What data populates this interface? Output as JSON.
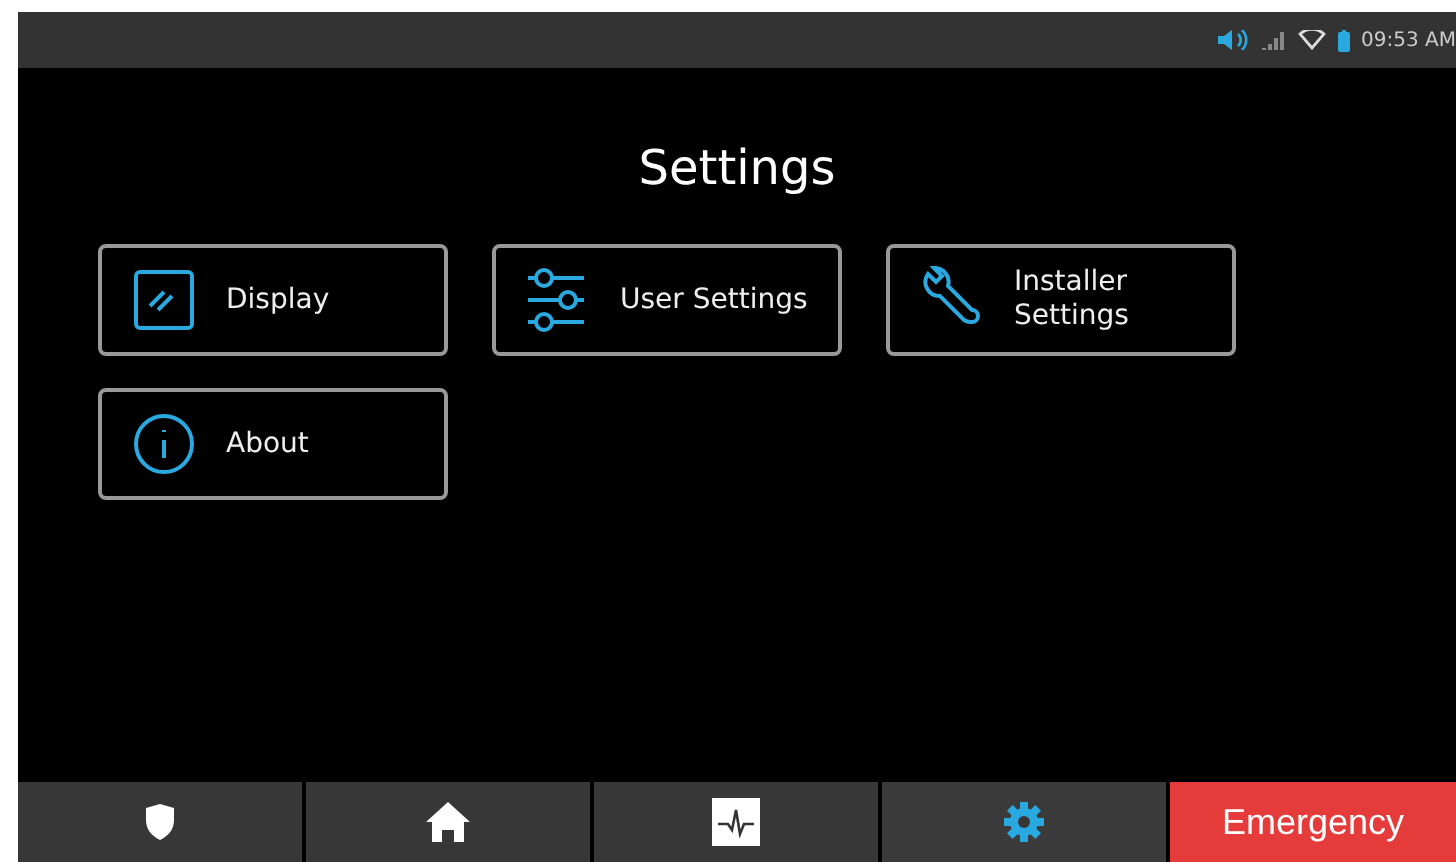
{
  "status_bar": {
    "time": "09:53 AM"
  },
  "title": "Settings",
  "tiles": [
    {
      "kind": "display",
      "label": "Display"
    },
    {
      "kind": "sliders",
      "label": "User Settings"
    },
    {
      "kind": "wrench",
      "label": "Installer Settings"
    },
    {
      "kind": "info",
      "label": "About"
    }
  ],
  "nav": [
    {
      "kind": "shield",
      "selected": false
    },
    {
      "kind": "home",
      "selected": false
    },
    {
      "kind": "pulse",
      "selected": false
    },
    {
      "kind": "gear",
      "selected": true
    }
  ],
  "emergency": "Emergency"
}
